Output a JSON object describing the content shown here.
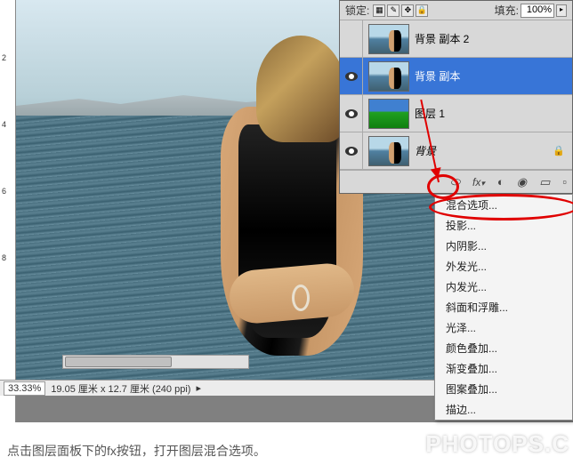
{
  "ruler": {
    "t2": "2",
    "t4": "4",
    "t6": "6",
    "t8": "8"
  },
  "panel": {
    "lock_label": "锁定:",
    "fill_label": "填充:",
    "fill_value": "100%"
  },
  "layers": [
    {
      "name": "背景 副本 2",
      "selected": false,
      "eye": false,
      "thumb": "photo"
    },
    {
      "name": "背景 副本",
      "selected": true,
      "eye": true,
      "thumb": "photo"
    },
    {
      "name": "图层 1",
      "selected": false,
      "eye": true,
      "thumb": "landscape"
    },
    {
      "name": "背景",
      "selected": false,
      "eye": true,
      "thumb": "photo",
      "italic": true,
      "locked": true
    }
  ],
  "footer": {
    "fx": "fx",
    "link": "⬭",
    "mask": "◐",
    "adj": "●",
    "group": "▭",
    "new": "▫",
    "del": "🗑"
  },
  "fx_menu": [
    "混合选项...",
    "投影...",
    "内阴影...",
    "外发光...",
    "内发光...",
    "斜面和浮雕...",
    "光泽...",
    "颜色叠加...",
    "渐变叠加...",
    "图案叠加...",
    "描边..."
  ],
  "status": {
    "zoom": "33.33%",
    "info": "19.05 厘米 x 12.7 厘米 (240 ppi)"
  },
  "caption": "点击图层面板下的fx按钮，打开图层混合选项。",
  "watermark": "PHOTOPS.C",
  "icons": {
    "lock": "🔒",
    "arrow": "▸",
    "dd": "▾"
  }
}
